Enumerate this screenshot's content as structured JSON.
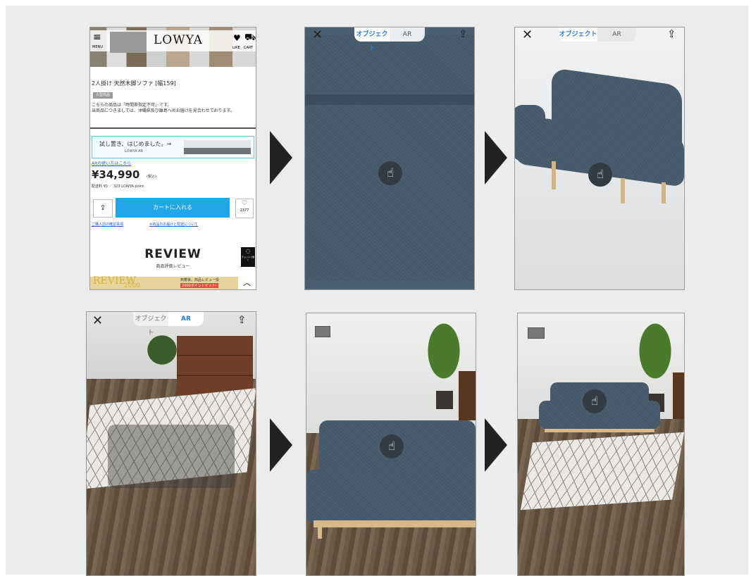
{
  "shop": {
    "menu_label": "MENU",
    "logo": "LOWYA",
    "like_label": "LIKE",
    "cart_label": "CART",
    "product_title": "2人掛け 天然木脚ソファ [幅159]",
    "tag": "大型商品",
    "notice_line1": "こちらの商品は「時間帯指定不可」です。",
    "notice_line2": "当商品につきましては、沖縄県及び離島へのお届けを見合わせております。",
    "ar_banner_text": "試し置き、はじめました。→",
    "ar_banner_sub": "LOWYA AR",
    "ar_howto_link": "ARの使い方はこちら",
    "price": "¥34,990",
    "tax_note": "(税込)",
    "shipping_points": "配送料 ¥0 ／ 323 LOWYA point",
    "add_to_cart": "カートに入れる",
    "like_count": "1377",
    "link_confirm": "ご購入前の確認事項",
    "link_delivery": "※商品のお届けと配送について",
    "review_heading": "REVIEW",
    "review_sub": "商品評価レビュー",
    "chat_label": "チャットで聞く",
    "bottom_banner_left": "REVIEW",
    "bottom_banner_year": "2000",
    "bottom_banner_right": "到着後、商品レビュー投",
    "bottom_banner_points": "2000ポイントゲット!"
  },
  "viewer": {
    "tab_object": "オブジェクト",
    "tab_ar": "AR",
    "close_icon": "close-icon",
    "share_icon": "share-icon",
    "hand_icon": "hand-gesture-icon"
  }
}
